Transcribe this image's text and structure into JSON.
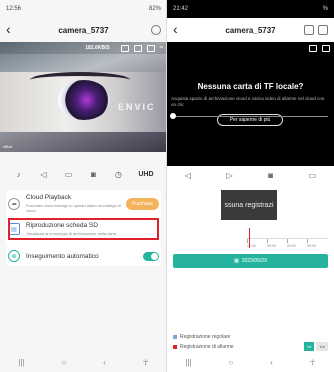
{
  "left": {
    "status": {
      "time": "12:56",
      "battery": "82%"
    },
    "header": {
      "title": "camera_5737"
    },
    "video": {
      "speed": "182.6KB/S",
      "brand": "ENVIC",
      "watermark": "office"
    },
    "controls": {
      "uhd": "UHD"
    },
    "cloud": {
      "title": "Cloud Playback",
      "subtitle": "Purchase cloud storage to upload alarm recordings to cloud",
      "button": "Purchase"
    },
    "sd": {
      "title": "Riproduzione scheda SD",
      "subtitle": "Visualizza la cronologia di archiviazione della carta"
    },
    "tracking": {
      "title": "Inseguimento automatico"
    }
  },
  "right": {
    "status": {
      "time": "21:42",
      "battery": "%"
    },
    "header": {
      "title": "camera_5737"
    },
    "message": {
      "title": "Nessuna carta di TF locale?",
      "desc": "Acquista spazio di archiviazione cloud e carica video di allarme nel cloud con un clic",
      "button": "Per saperne di più"
    },
    "timeline": {
      "placeholder": "ssuna registrazi",
      "ticks": [
        "00:00",
        "00:00",
        "00:00",
        "00:00"
      ]
    },
    "date": "2023/05/29",
    "legend": [
      {
        "label": "Registrazione regolare",
        "color": "#7aa7e0"
      },
      {
        "label": "Registrazione di allarme",
        "color": "#e2212a"
      }
    ],
    "zoom": {
      "a": "Ist",
      "b": "1m"
    }
  }
}
